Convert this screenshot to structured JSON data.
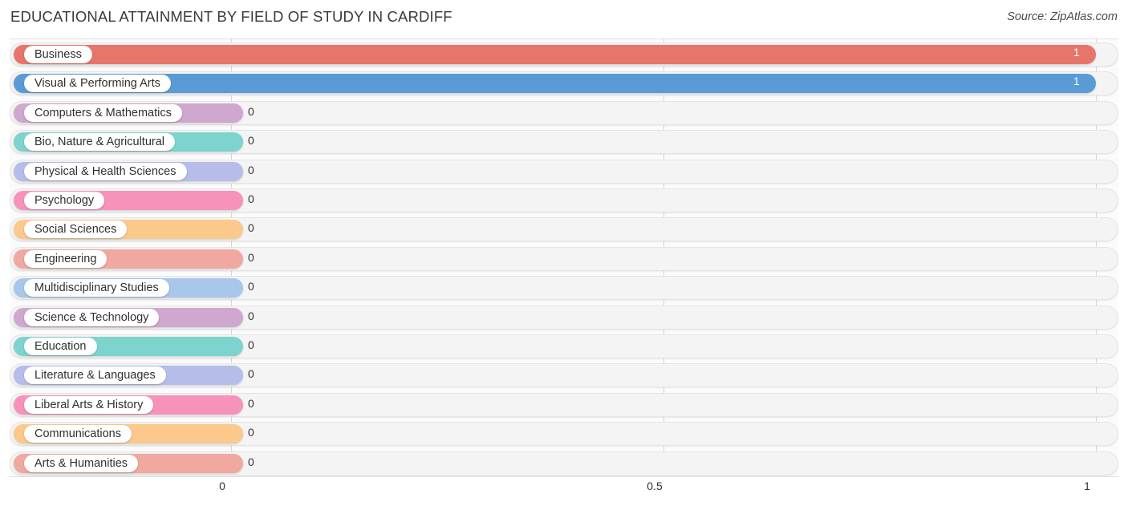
{
  "header": {
    "title": "EDUCATIONAL ATTAINMENT BY FIELD OF STUDY IN CARDIFF",
    "source": "Source: ZipAtlas.com"
  },
  "chart_data": {
    "type": "bar",
    "orientation": "horizontal",
    "title": "EDUCATIONAL ATTAINMENT BY FIELD OF STUDY IN CARDIFF",
    "xlabel": "",
    "ylabel": "",
    "xlim": [
      0,
      1
    ],
    "xticks": [
      "0",
      "0.5",
      "1"
    ],
    "xtick_values": [
      0,
      0.5,
      1
    ],
    "grid": true,
    "legend": "none",
    "categories": [
      "Business",
      "Visual & Performing Arts",
      "Computers & Mathematics",
      "Bio, Nature & Agricultural",
      "Physical & Health Sciences",
      "Psychology",
      "Social Sciences",
      "Engineering",
      "Multidisciplinary Studies",
      "Science & Technology",
      "Education",
      "Literature & Languages",
      "Liberal Arts & History",
      "Communications",
      "Arts & Humanities"
    ],
    "values": [
      1,
      1,
      0,
      0,
      0,
      0,
      0,
      0,
      0,
      0,
      0,
      0,
      0,
      0,
      0
    ],
    "value_labels": [
      "1",
      "1",
      "0",
      "0",
      "0",
      "0",
      "0",
      "0",
      "0",
      "0",
      "0",
      "0",
      "0",
      "0",
      "0"
    ],
    "colors": [
      "#e8756b",
      "#5b9bd5",
      "#cfa8cf",
      "#7dd3cd",
      "#b6bdea",
      "#f792bb",
      "#fbc98c",
      "#f0a8a0",
      "#a8c7ea",
      "#cfa8cf",
      "#7dd3cd",
      "#b6bdea",
      "#f792bb",
      "#fbc98c",
      "#f0a8a0"
    ]
  }
}
